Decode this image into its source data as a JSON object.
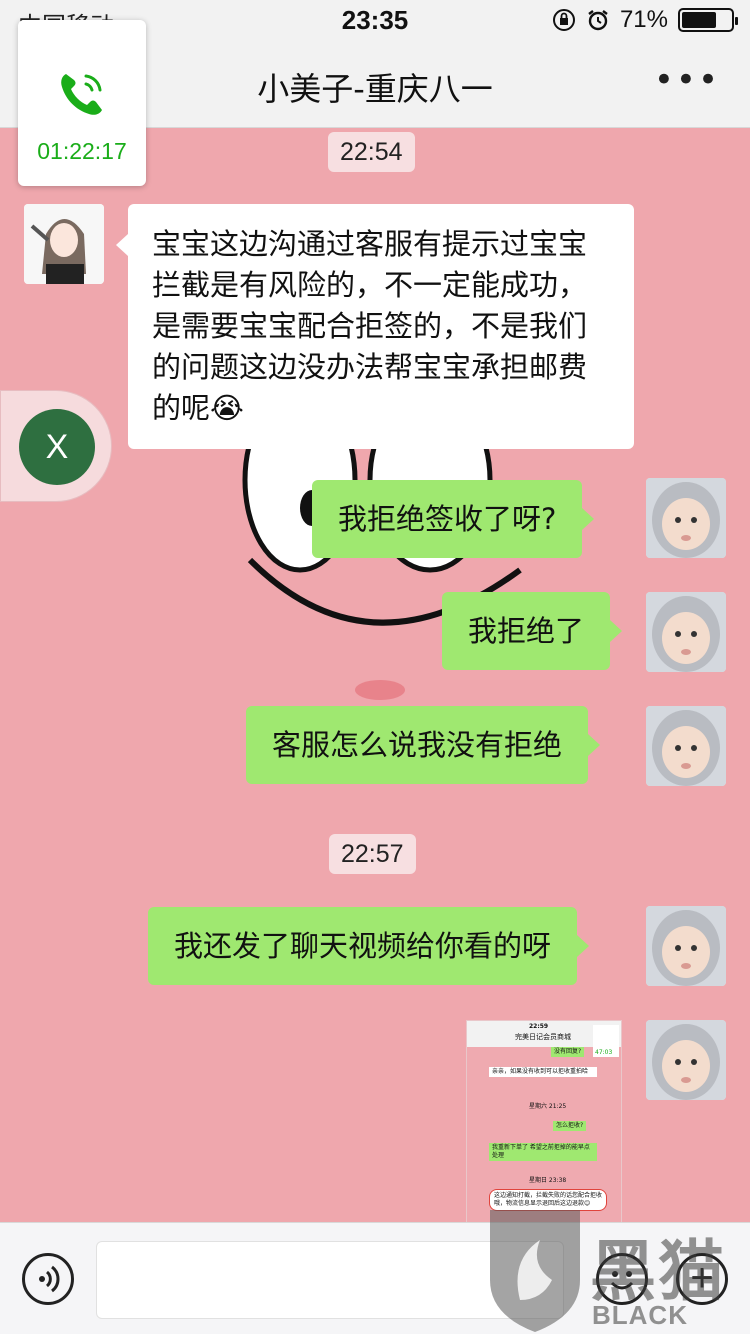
{
  "status_bar": {
    "carrier": "中国移动",
    "time": "23:35",
    "battery_percent": "71%",
    "battery_level": 0.71,
    "icons": [
      "signal-icon",
      "wifi-icon",
      "orientation-lock-icon",
      "alarm-icon",
      "battery-icon"
    ]
  },
  "nav": {
    "title": "小美子-重庆八一",
    "more_label": "•••"
  },
  "call_float": {
    "duration": "01:22:17",
    "icon": "phone-icon",
    "color": "#1aad19"
  },
  "float_app": {
    "letter": "X",
    "color": "#2e6f40"
  },
  "timestamps": [
    "22:54",
    "22:57"
  ],
  "messages": [
    {
      "from": "contact",
      "text": "宝宝这边沟通过客服有提示过宝宝拦截是有风险的，不一定能成功，是需要宝宝配合拒签的，不是我们的问题这边没办法帮宝宝承担邮费的呢😭"
    },
    {
      "from": "me",
      "text": "我拒绝签收了呀?"
    },
    {
      "from": "me",
      "text": "我拒绝了"
    },
    {
      "from": "me",
      "text": "客服怎么说我没有拒绝"
    },
    {
      "from": "me",
      "text": "我还发了聊天视频给你看的呀"
    },
    {
      "from": "me",
      "type": "image"
    }
  ],
  "image_message": {
    "time": "22:59",
    "title": "完美日记会员商城",
    "call_duration": "47:03",
    "lines": [
      "没有回复?",
      "亲亲，如果没有收到可以拒收重拍哈",
      "星期六 21:25",
      "怎么拒收?",
      "我重新下单了 希望之前拒掉的能早点处理",
      "星期日 23:38",
      "这边通知打截，拦截失败的话您配合拒收哦，物流信息显示退回后这边退款😊"
    ]
  },
  "input_bar": {
    "voice_icon": "voice-icon",
    "emoji_icon": "emoji-icon",
    "plus_icon": "plus-icon",
    "plus_glyph": "+"
  },
  "watermark": {
    "cn": "黑猫",
    "en": "BLACK CAT"
  },
  "colors": {
    "chat_background": "#efa7ad",
    "bubble_out": "#9fe870",
    "bubble_in": "#ffffff"
  }
}
